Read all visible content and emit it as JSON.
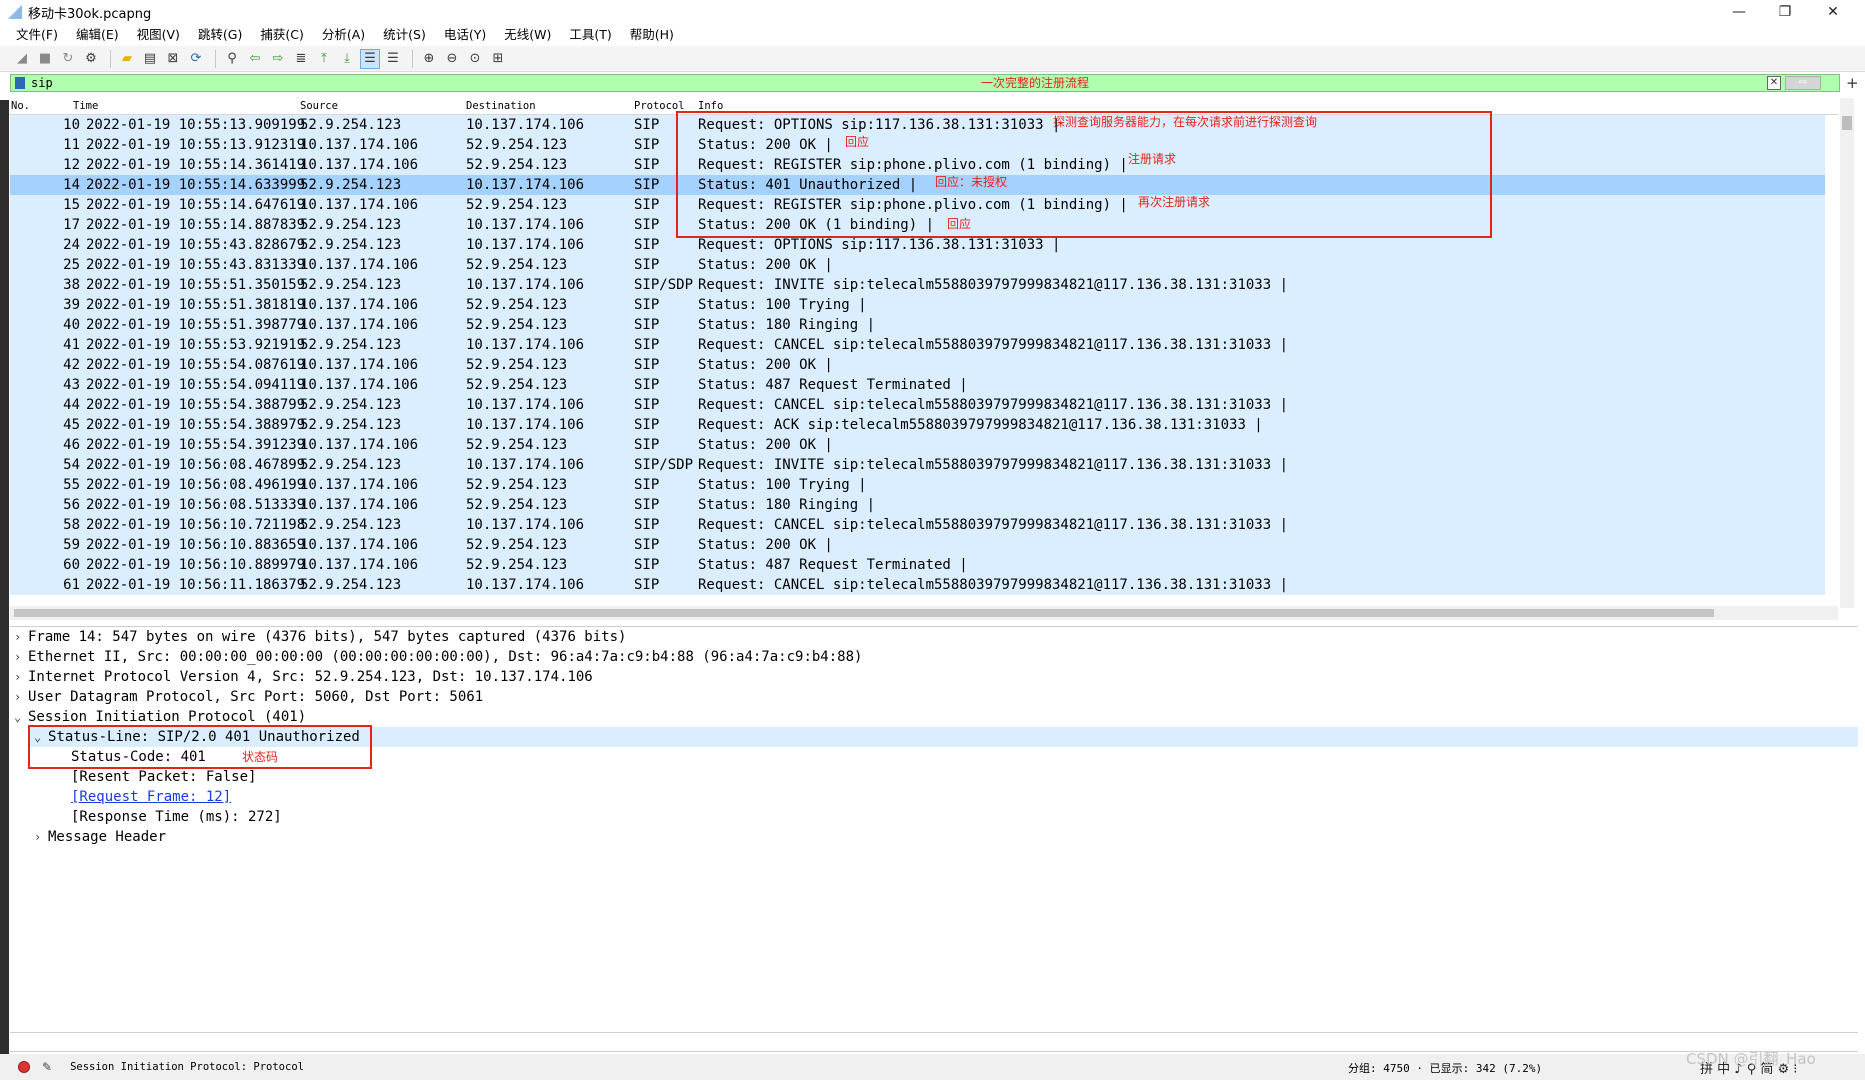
{
  "window": {
    "title": "移动卡30ok.pcapng",
    "minimize": "—",
    "restore": "❐",
    "close": "✕"
  },
  "menu": [
    "文件(F)",
    "编辑(E)",
    "视图(V)",
    "跳转(G)",
    "捕获(C)",
    "分析(A)",
    "统计(S)",
    "电话(Y)",
    "无线(W)",
    "工具(T)",
    "帮助(H)"
  ],
  "toolbar_icons": [
    "start-capture-icon",
    "stop-capture-icon",
    "restart-capture-icon",
    "capture-options-icon",
    "open-file-icon",
    "save-file-icon",
    "close-file-icon",
    "reload-file-icon",
    "find-packet-icon",
    "go-back-icon",
    "go-forward-icon",
    "go-to-packet-icon",
    "go-first-icon",
    "go-last-icon",
    "autoscroll-icon",
    "colorize-icon",
    "zoom-in-icon",
    "zoom-out-icon",
    "zoom-normal-icon",
    "resize-columns-icon"
  ],
  "filter": {
    "value": "sip",
    "note": "一次完整的注册流程",
    "clear": "✕",
    "apply": "⇨",
    "add": "+"
  },
  "columns": {
    "no": "No.",
    "time": "Time",
    "source": "Source",
    "destination": "Destination",
    "protocol": "Protocol",
    "info": "Info"
  },
  "packets": [
    {
      "no": "10",
      "time": "2022-01-19 10:55:13.909199",
      "src": "52.9.254.123",
      "dst": "10.137.174.106",
      "proto": "SIP",
      "info": "Request: OPTIONS sip:117.136.38.131:31033 |"
    },
    {
      "no": "11",
      "time": "2022-01-19 10:55:13.912319",
      "src": "10.137.174.106",
      "dst": "52.9.254.123",
      "proto": "SIP",
      "info": "Status: 200 OK |"
    },
    {
      "no": "12",
      "time": "2022-01-19 10:55:14.361419",
      "src": "10.137.174.106",
      "dst": "52.9.254.123",
      "proto": "SIP",
      "info": "Request: REGISTER sip:phone.plivo.com  (1 binding) |"
    },
    {
      "no": "14",
      "time": "2022-01-19 10:55:14.633999",
      "src": "52.9.254.123",
      "dst": "10.137.174.106",
      "proto": "SIP",
      "info": "Status: 401 Unauthorized |"
    },
    {
      "no": "15",
      "time": "2022-01-19 10:55:14.647619",
      "src": "10.137.174.106",
      "dst": "52.9.254.123",
      "proto": "SIP",
      "info": "Request: REGISTER sip:phone.plivo.com  (1 binding) |"
    },
    {
      "no": "17",
      "time": "2022-01-19 10:55:14.887839",
      "src": "52.9.254.123",
      "dst": "10.137.174.106",
      "proto": "SIP",
      "info": "Status: 200 OK  (1 binding) |"
    },
    {
      "no": "24",
      "time": "2022-01-19 10:55:43.828679",
      "src": "52.9.254.123",
      "dst": "10.137.174.106",
      "proto": "SIP",
      "info": "Request: OPTIONS sip:117.136.38.131:31033 |"
    },
    {
      "no": "25",
      "time": "2022-01-19 10:55:43.831339",
      "src": "10.137.174.106",
      "dst": "52.9.254.123",
      "proto": "SIP",
      "info": "Status: 200 OK |"
    },
    {
      "no": "38",
      "time": "2022-01-19 10:55:51.350159",
      "src": "52.9.254.123",
      "dst": "10.137.174.106",
      "proto": "SIP/SDP",
      "info": "Request: INVITE sip:telecalm5588039797999834821@117.136.38.131:31033 |"
    },
    {
      "no": "39",
      "time": "2022-01-19 10:55:51.381819",
      "src": "10.137.174.106",
      "dst": "52.9.254.123",
      "proto": "SIP",
      "info": "Status: 100 Trying |"
    },
    {
      "no": "40",
      "time": "2022-01-19 10:55:51.398779",
      "src": "10.137.174.106",
      "dst": "52.9.254.123",
      "proto": "SIP",
      "info": "Status: 180 Ringing |"
    },
    {
      "no": "41",
      "time": "2022-01-19 10:55:53.921919",
      "src": "52.9.254.123",
      "dst": "10.137.174.106",
      "proto": "SIP",
      "info": "Request: CANCEL sip:telecalm5588039797999834821@117.136.38.131:31033 |"
    },
    {
      "no": "42",
      "time": "2022-01-19 10:55:54.087619",
      "src": "10.137.174.106",
      "dst": "52.9.254.123",
      "proto": "SIP",
      "info": "Status: 200 OK |"
    },
    {
      "no": "43",
      "time": "2022-01-19 10:55:54.094119",
      "src": "10.137.174.106",
      "dst": "52.9.254.123",
      "proto": "SIP",
      "info": "Status: 487 Request Terminated |"
    },
    {
      "no": "44",
      "time": "2022-01-19 10:55:54.388799",
      "src": "52.9.254.123",
      "dst": "10.137.174.106",
      "proto": "SIP",
      "info": "Request: CANCEL sip:telecalm5588039797999834821@117.136.38.131:31033 |"
    },
    {
      "no": "45",
      "time": "2022-01-19 10:55:54.388979",
      "src": "52.9.254.123",
      "dst": "10.137.174.106",
      "proto": "SIP",
      "info": "Request: ACK sip:telecalm5588039797999834821@117.136.38.131:31033 |"
    },
    {
      "no": "46",
      "time": "2022-01-19 10:55:54.391239",
      "src": "10.137.174.106",
      "dst": "52.9.254.123",
      "proto": "SIP",
      "info": "Status: 200 OK |"
    },
    {
      "no": "54",
      "time": "2022-01-19 10:56:08.467899",
      "src": "52.9.254.123",
      "dst": "10.137.174.106",
      "proto": "SIP/SDP",
      "info": "Request: INVITE sip:telecalm5588039797999834821@117.136.38.131:31033 |"
    },
    {
      "no": "55",
      "time": "2022-01-19 10:56:08.496199",
      "src": "10.137.174.106",
      "dst": "52.9.254.123",
      "proto": "SIP",
      "info": "Status: 100 Trying |"
    },
    {
      "no": "56",
      "time": "2022-01-19 10:56:08.513339",
      "src": "10.137.174.106",
      "dst": "52.9.254.123",
      "proto": "SIP",
      "info": "Status: 180 Ringing |"
    },
    {
      "no": "58",
      "time": "2022-01-19 10:56:10.721198",
      "src": "52.9.254.123",
      "dst": "10.137.174.106",
      "proto": "SIP",
      "info": "Request: CANCEL sip:telecalm5588039797999834821@117.136.38.131:31033 |"
    },
    {
      "no": "59",
      "time": "2022-01-19 10:56:10.883659",
      "src": "10.137.174.106",
      "dst": "52.9.254.123",
      "proto": "SIP",
      "info": "Status: 200 OK |"
    },
    {
      "no": "60",
      "time": "2022-01-19 10:56:10.889979",
      "src": "10.137.174.106",
      "dst": "52.9.254.123",
      "proto": "SIP",
      "info": "Status: 487 Request Terminated |"
    },
    {
      "no": "61",
      "time": "2022-01-19 10:56:11.186379",
      "src": "52.9.254.123",
      "dst": "10.137.174.106",
      "proto": "SIP",
      "info": "Request: CANCEL sip:telecalm5588039797999834821@117.136.38.131:31033 |"
    }
  ],
  "selected_packet_no": "14",
  "packet_notes": {
    "options": "探测查询服务器能力，在每次请求前进行探测查询",
    "reply_11": "回应",
    "register": "注册请求",
    "reply_401": "回应：未授权",
    "reregister": "再次注册请求",
    "reply_17": "回应"
  },
  "details": {
    "frame": "Frame 14: 547 bytes on wire (4376 bits), 547 bytes captured (4376 bits)",
    "ethernet": "Ethernet II, Src: 00:00:00_00:00:00 (00:00:00:00:00:00), Dst: 96:a4:7a:c9:b4:88 (96:a4:7a:c9:b4:88)",
    "ip": "Internet Protocol Version 4, Src: 52.9.254.123, Dst: 10.137.174.106",
    "udp": "User Datagram Protocol, Src Port: 5060, Dst Port: 5061",
    "sip": "Session Initiation Protocol (401)",
    "status_line": "Status-Line: SIP/2.0 401 Unauthorized",
    "status_code": "Status-Code: 401",
    "status_code_note": "状态码",
    "resent": "[Resent Packet: False]",
    "request_frame": "[Request Frame: 12]",
    "response_time": "[Response Time (ms): 272]",
    "message_header": "Message Header"
  },
  "statusbar": {
    "text": "Session Initiation Protocol: Protocol",
    "counts": "分组: 4750 · 已显示: 342 (7.2%)",
    "ime": "拼 中 ♪ ⚲ 简 ⚙ ⁝",
    "watermark": "CSDN @引翻_Hao"
  },
  "colors": {
    "filter_ok": "#afffaf",
    "row_sip": "#daeeff",
    "row_selected": "#a5d1ff",
    "annotation": "#e0261b",
    "link": "#1a3ce0"
  }
}
